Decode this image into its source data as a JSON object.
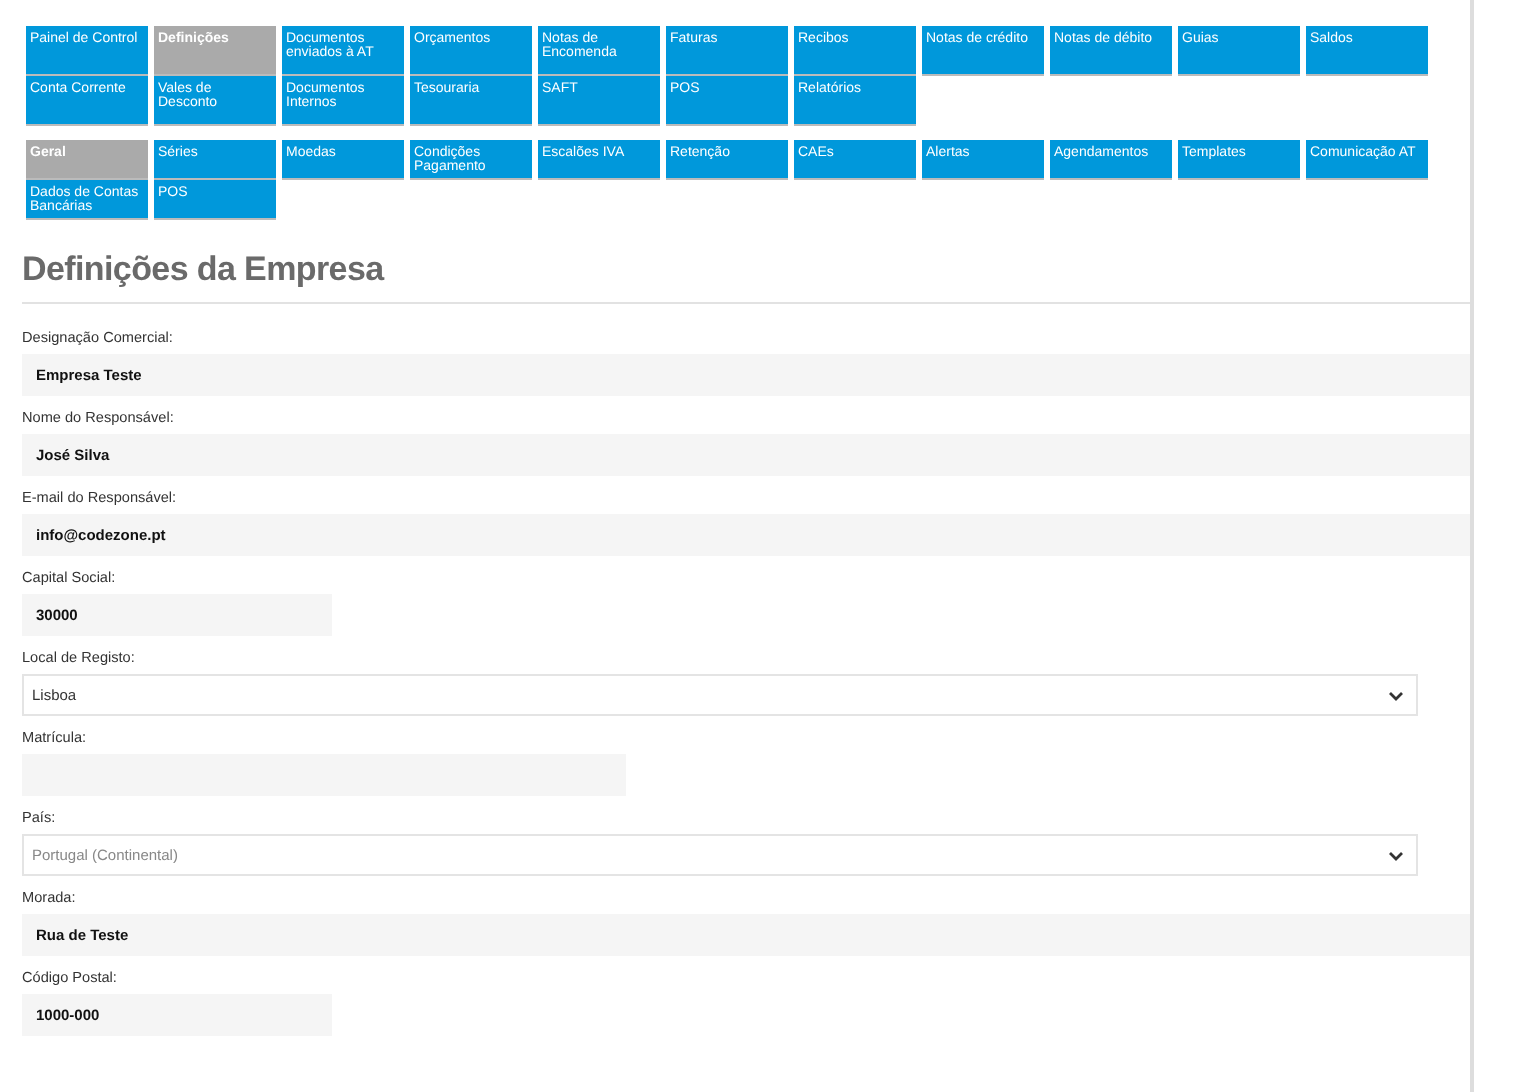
{
  "main_tabs": [
    {
      "label": "Painel de Control",
      "selected": false
    },
    {
      "label": "Definições",
      "selected": true
    },
    {
      "label": "Documentos enviados à AT",
      "selected": false
    },
    {
      "label": "Orçamentos",
      "selected": false
    },
    {
      "label": "Notas de Encomenda",
      "selected": false
    },
    {
      "label": "Faturas",
      "selected": false
    },
    {
      "label": "Recibos",
      "selected": false
    },
    {
      "label": "Notas de crédito",
      "selected": false
    },
    {
      "label": "Notas de débito",
      "selected": false
    },
    {
      "label": "Guias",
      "selected": false
    },
    {
      "label": "Saldos",
      "selected": false
    },
    {
      "label": "Conta Corrente",
      "selected": false
    },
    {
      "label": "Vales de Desconto",
      "selected": false
    },
    {
      "label": "Documentos Internos",
      "selected": false
    },
    {
      "label": "Tesouraria",
      "selected": false
    },
    {
      "label": "SAFT",
      "selected": false
    },
    {
      "label": "POS",
      "selected": false
    },
    {
      "label": "Relatórios",
      "selected": false
    }
  ],
  "sub_tabs": [
    {
      "label": "Geral",
      "selected": true
    },
    {
      "label": "Séries",
      "selected": false
    },
    {
      "label": "Moedas",
      "selected": false
    },
    {
      "label": "Condições Pagamento",
      "selected": false
    },
    {
      "label": "Escalões IVA",
      "selected": false
    },
    {
      "label": "Retenção",
      "selected": false
    },
    {
      "label": "CAEs",
      "selected": false
    },
    {
      "label": "Alertas",
      "selected": false
    },
    {
      "label": "Agendamentos",
      "selected": false
    },
    {
      "label": "Templates",
      "selected": false
    },
    {
      "label": "Comunicação AT",
      "selected": false
    },
    {
      "label": "Dados de Contas Bancárias",
      "selected": false
    },
    {
      "label": "POS",
      "selected": false
    }
  ],
  "heading": "Definições da Empresa",
  "fields": [
    {
      "label": "Designação Comercial:",
      "kind": "wide",
      "value": "Empresa Teste"
    },
    {
      "label": "Nome do Responsável:",
      "kind": "wide",
      "value": "José Silva"
    },
    {
      "label": "E-mail do Responsável:",
      "kind": "wide",
      "value": "info@codezone.pt"
    },
    {
      "label": "Capital Social:",
      "kind": "short",
      "value": "30000"
    },
    {
      "label": "Local de Registo:",
      "kind": "select",
      "value": "Lisboa",
      "disabled": false
    },
    {
      "label": "Matrícula:",
      "kind": "medium"
    },
    {
      "label": "País:",
      "kind": "select",
      "value": "Portugal (Continental)",
      "disabled": true
    },
    {
      "label": "Morada:",
      "kind": "wide",
      "value": "Rua de Teste"
    },
    {
      "label": "Código Postal:",
      "kind": "short",
      "value": "1000-000"
    }
  ]
}
